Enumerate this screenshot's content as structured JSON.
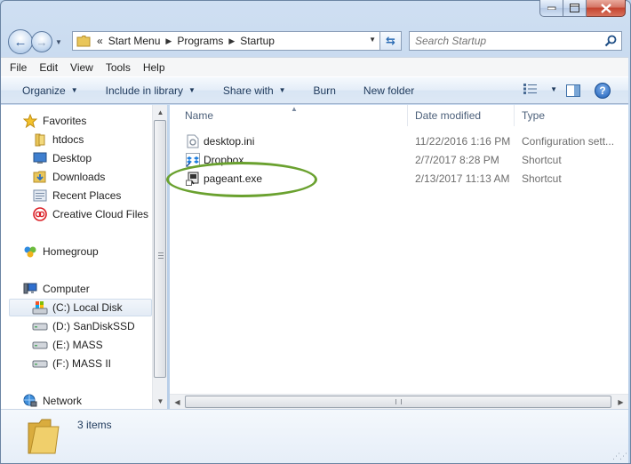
{
  "window": {
    "title": "Startup"
  },
  "address": {
    "overflow": "«",
    "crumbs": [
      "Start Menu",
      "Programs",
      "Startup"
    ]
  },
  "search": {
    "placeholder": "Search Startup"
  },
  "menu": [
    "File",
    "Edit",
    "View",
    "Tools",
    "Help"
  ],
  "toolbar": {
    "organize": "Organize",
    "include_in_library": "Include in library",
    "share_with": "Share with",
    "burn": "Burn",
    "new_folder": "New folder"
  },
  "sidebar": {
    "favorites": {
      "label": "Favorites",
      "items": [
        "htdocs",
        "Desktop",
        "Downloads",
        "Recent Places",
        "Creative Cloud Files"
      ]
    },
    "homegroup": "Homegroup",
    "computer": {
      "label": "Computer",
      "items": [
        "(C:) Local Disk",
        "(D:) SanDiskSSD",
        "(E:) MASS",
        "(F:) MASS II"
      ],
      "selected": "(C:) Local Disk"
    },
    "network": "Network"
  },
  "columns": {
    "name": "Name",
    "date_modified": "Date modified",
    "type": "Type"
  },
  "files": [
    {
      "name": "desktop.ini",
      "date": "11/22/2016 1:16 PM",
      "type": "Configuration sett...",
      "icon": "ini-file-icon"
    },
    {
      "name": "Dropbox",
      "date": "2/7/2017 8:28 PM",
      "type": "Shortcut",
      "icon": "dropbox-icon"
    },
    {
      "name": "pageant.exe",
      "date": "2/13/2017 11:13 AM",
      "type": "Shortcut",
      "icon": "pageant-icon"
    }
  ],
  "status": {
    "item_count": "3 items"
  },
  "colors": {
    "highlight_ellipse": "#6aa12f",
    "accent": "#1e395b"
  }
}
